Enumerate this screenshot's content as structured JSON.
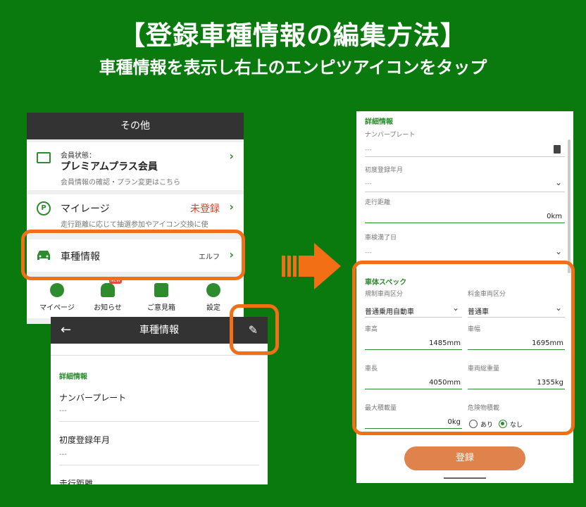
{
  "heading": {
    "main": "【登録車種情報の編集方法】",
    "sub": "車種情報を表示し右上のエンピツアイコンをタップ"
  },
  "screen_other": {
    "title": "その他",
    "member": {
      "label": "会員状態：",
      "value": "プレミアムプラス会員",
      "note": "会員情報の確認・プラン変更はこちら"
    },
    "mileage": {
      "label": "マイレージ",
      "status": "未登録",
      "note": "走行距離に応じて抽選参加やアイコン交換に使"
    },
    "vehicle": {
      "label": "車種情報",
      "value": "エルフ"
    },
    "nav": [
      {
        "label": "マイページ"
      },
      {
        "label": "お知らせ",
        "badge": "NEW"
      },
      {
        "label": "ご意見箱"
      },
      {
        "label": "設定"
      }
    ]
  },
  "screen_vehicle": {
    "title": "車種情報",
    "section": "詳細情報",
    "fields": [
      {
        "label": "ナンバープレート",
        "value": "---"
      },
      {
        "label": "初度登録年月",
        "value": "---"
      },
      {
        "label": "走行距離"
      }
    ]
  },
  "screen_edit": {
    "detail_section": "詳細情報",
    "number_plate": {
      "label": "ナンバープレート",
      "value": "---"
    },
    "first_reg": {
      "label": "初度登録年月",
      "value": "---"
    },
    "mileage": {
      "label": "走行距離",
      "value": "0km"
    },
    "inspection": {
      "label": "車検満了日",
      "value": "---"
    },
    "spec_section": "車体スペック",
    "reg_class": {
      "label": "規制車両区分",
      "value": "普通乗用自動車"
    },
    "fee_class": {
      "label": "料金車両区分",
      "value": "普通車"
    },
    "height": {
      "label": "車高",
      "value": "1485mm"
    },
    "width": {
      "label": "車幅",
      "value": "1695mm"
    },
    "length": {
      "label": "車長",
      "value": "4050mm"
    },
    "gross_weight": {
      "label": "車両総重量",
      "value": "1355kg"
    },
    "max_load": {
      "label": "最大積載量",
      "value": "0kg"
    },
    "hazmat": {
      "label": "危険物積載",
      "options": [
        "あり",
        "なし"
      ],
      "selected": "なし"
    },
    "register_button": "登録"
  },
  "colors": {
    "background": "#0b7a0e",
    "accent_green": "#2e8b2e",
    "highlight_orange": "#f26f16",
    "button_orange": "#e0824c"
  }
}
